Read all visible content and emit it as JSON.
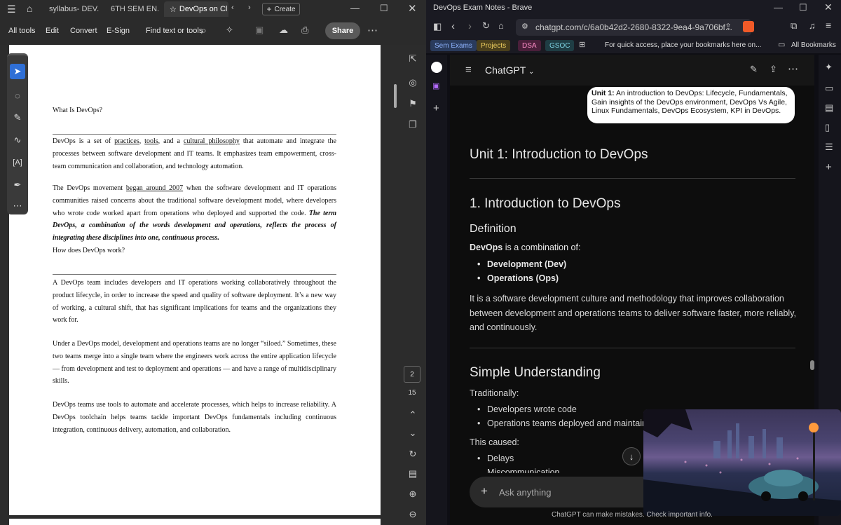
{
  "pdf": {
    "tabs": [
      "syllabus- DEV...",
      "6TH SEM EN...",
      "DevOps on Cl"
    ],
    "new_tab_label": "Create",
    "menu": [
      "All tools",
      "Edit",
      "Convert",
      "E-Sign"
    ],
    "find_label": "Find text or tools",
    "share_label": "Share",
    "page_number": "2",
    "page_total": "15",
    "doc": {
      "heading1": "What Is DevOps?",
      "p1_a": "DevOps is a set of ",
      "p1_practices": "practices",
      "p1_b": ", ",
      "p1_tools": "tools",
      "p1_c": ", and a ",
      "p1_cultural": "cultural philosophy",
      "p1_d": " that automate and integrate the processes between software development and IT teams. It emphasizes team empowerment, cross-team communication and collaboration, and technology automation.",
      "p2_a": "The DevOps movement ",
      "p2_began": "began around 2007",
      "p2_b": " when the software development and IT operations communities raised concerns about the traditional software development model, where developers who wrote code worked apart from operations who deployed and supported the code.",
      "p2_bold": "The term DevOps, a combination of the words development and operations, reflects the process of integrating these disciplines into one, continuous process.",
      "heading2": "How does DevOps work?",
      "p3": "A DevOps team includes developers and IT operations working collaboratively throughout the product lifecycle, in order to increase the speed and quality of software deployment. It’s a new way of working, a cultural shift, that has significant implications for teams and the organizations they work for.",
      "p4": "Under a DevOps model, development and operations teams are no longer “siloed.” Sometimes, these two teams merge into a single team where the engineers work across the entire application lifecycle — from development and test to deployment and operations — and have a range of multidisciplinary skills.",
      "p5": "DevOps teams use tools to automate and accelerate processes, which helps to increase reliability. A DevOps toolchain helps teams tackle important DevOps fundamentals including continuous integration, continuous delivery, automation, and collaboration."
    }
  },
  "browser": {
    "window_title": "DevOps Exam Notes - Brave",
    "url": "chatgpt.com/c/6a0b42d2-2680-8322-9ea4-9a706bf...",
    "bookmarks": [
      {
        "label": "Sem Exams",
        "color": "#2a3b5c",
        "text": "#8fb4ff"
      },
      {
        "label": "Projects",
        "color": "#4a3f1c",
        "text": "#f0d060"
      },
      {
        "label": "DSA",
        "color": "#4a1f3a",
        "text": "#ff8fc8"
      },
      {
        "label": "GSOC",
        "color": "#1f3d44",
        "text": "#7fd6e6"
      }
    ],
    "bookmark_hint": "For quick access, place your bookmarks here on...",
    "all_bookmarks": "All Bookmarks"
  },
  "chat": {
    "model": "ChatGPT",
    "user_message_bold": "Unit 1:",
    "user_message": " An introduction to DevOps: Lifecycle, Fundamentals, Gain insights of the DevOps environment, DevOps Vs Agile, Linux Fundamentals, DevOps Ecosystem, KPI in DevOps.",
    "h_unit": "Unit 1: Introduction to DevOps",
    "h_intro": "1. Introduction to DevOps",
    "h_def": "Definition",
    "def_bold": "DevOps",
    "def_rest": " is a combination of:",
    "def_items": [
      "Development (Dev)",
      "Operations (Ops)"
    ],
    "def_para": "It is a software development culture and methodology that improves collaboration between development and operations teams to deliver software faster, more reliably, and continuously.",
    "h_simple": "Simple Understanding",
    "trad": "Traditionally:",
    "trad_items": [
      "Developers wrote code",
      "Operations teams deployed and maintain"
    ],
    "caused": "This caused:",
    "caused_items": [
      "Delays",
      "Miscommunication"
    ],
    "ask_placeholder": "Ask anything",
    "footer": "ChatGPT can make mistakes. Check important info."
  }
}
